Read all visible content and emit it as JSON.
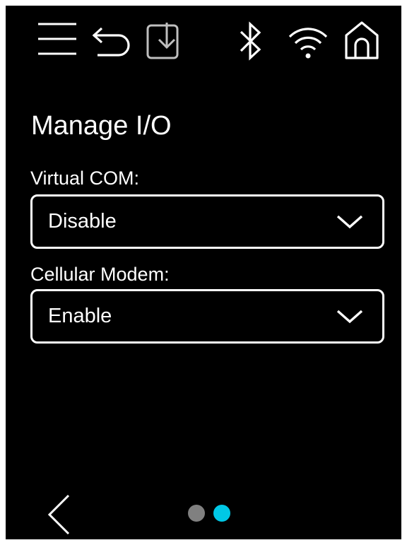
{
  "topbar": {
    "icons": [
      "menu-icon",
      "undo-icon",
      "import-icon",
      "bluetooth-icon",
      "wifi-icon",
      "home-icon"
    ]
  },
  "page": {
    "title": "Manage I/O"
  },
  "fields": [
    {
      "label": "Virtual COM:",
      "value": "Disable"
    },
    {
      "label": "Cellular Modem:",
      "value": "Enable"
    }
  ],
  "footer": {
    "back_icon": "chevron-left-icon",
    "pages_total": 2,
    "current_page": 2
  },
  "colors": {
    "background": "#000000",
    "foreground": "#ffffff",
    "icon_dim": "#bfbfbf",
    "dot_inactive": "#808080",
    "dot_active": "#00c8e6"
  }
}
